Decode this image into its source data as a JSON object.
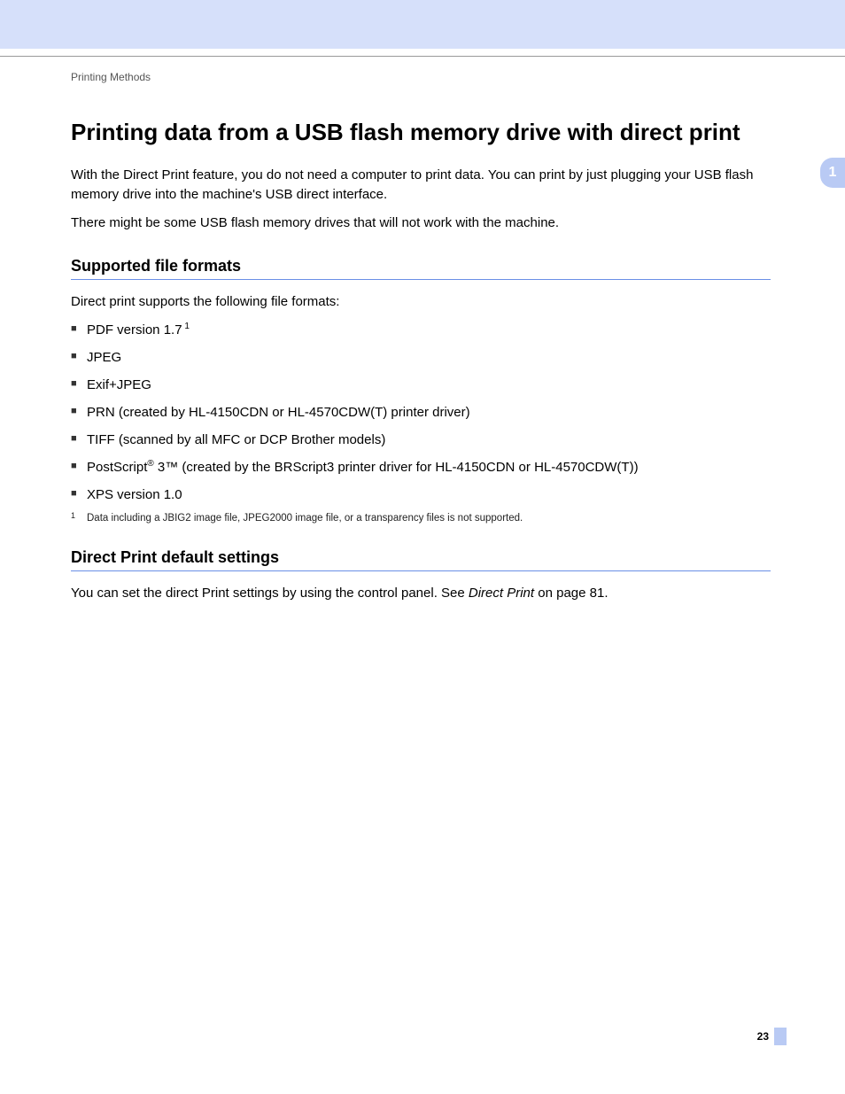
{
  "header": {
    "section_label": "Printing Methods"
  },
  "tab": {
    "chapter_number": "1"
  },
  "title": "Printing data from a USB flash memory drive with direct print",
  "intro_p1": "With the Direct Print feature, you do not need a computer to print data. You can print by just plugging your USB flash memory drive into the machine's USB direct interface.",
  "intro_p2": "There might be some USB flash memory drives that will not work with the machine.",
  "section1": {
    "heading": "Supported file formats",
    "lead": "Direct print supports the following file formats:",
    "items": {
      "i0_pre": "PDF version 1.7",
      "i0_sup": " 1",
      "i1": "JPEG",
      "i2": "Exif+JPEG",
      "i3": "PRN (created by HL-4150CDN or HL-4570CDW(T) printer driver)",
      "i4": "TIFF (scanned by all MFC or DCP Brother models)",
      "i5_a": "PostScript",
      "i5_reg": "®",
      "i5_b": " 3™ (created by the BRScript3 printer driver for HL-4150CDN or HL-4570CDW(T))",
      "i6": "XPS version 1.0"
    },
    "footnote_num": "1",
    "footnote_text": "Data including a JBIG2 image file, JPEG2000 image file, or a transparency files is not supported."
  },
  "section2": {
    "heading": "Direct Print default settings",
    "p_a": "You can set the direct Print settings by using the control panel. See ",
    "p_link": "Direct Print",
    "p_b": " on page 81."
  },
  "footer": {
    "page_number": "23"
  }
}
